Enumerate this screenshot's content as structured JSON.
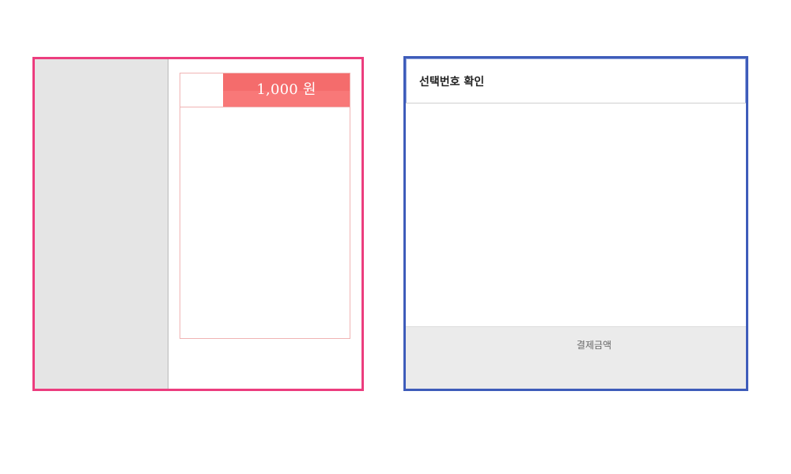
{
  "ticket_panel": {
    "price_label": "1,000 원"
  },
  "confirm_panel": {
    "title": "선택번호 확인",
    "payment_label": "결제금액"
  },
  "colors": {
    "ticket_border": "#ec3d7e",
    "price_tag": "#f46c6c",
    "confirm_border": "#3e5cba",
    "sidebar_bg": "#e5e5e5",
    "footer_bg": "#ebebeb"
  }
}
